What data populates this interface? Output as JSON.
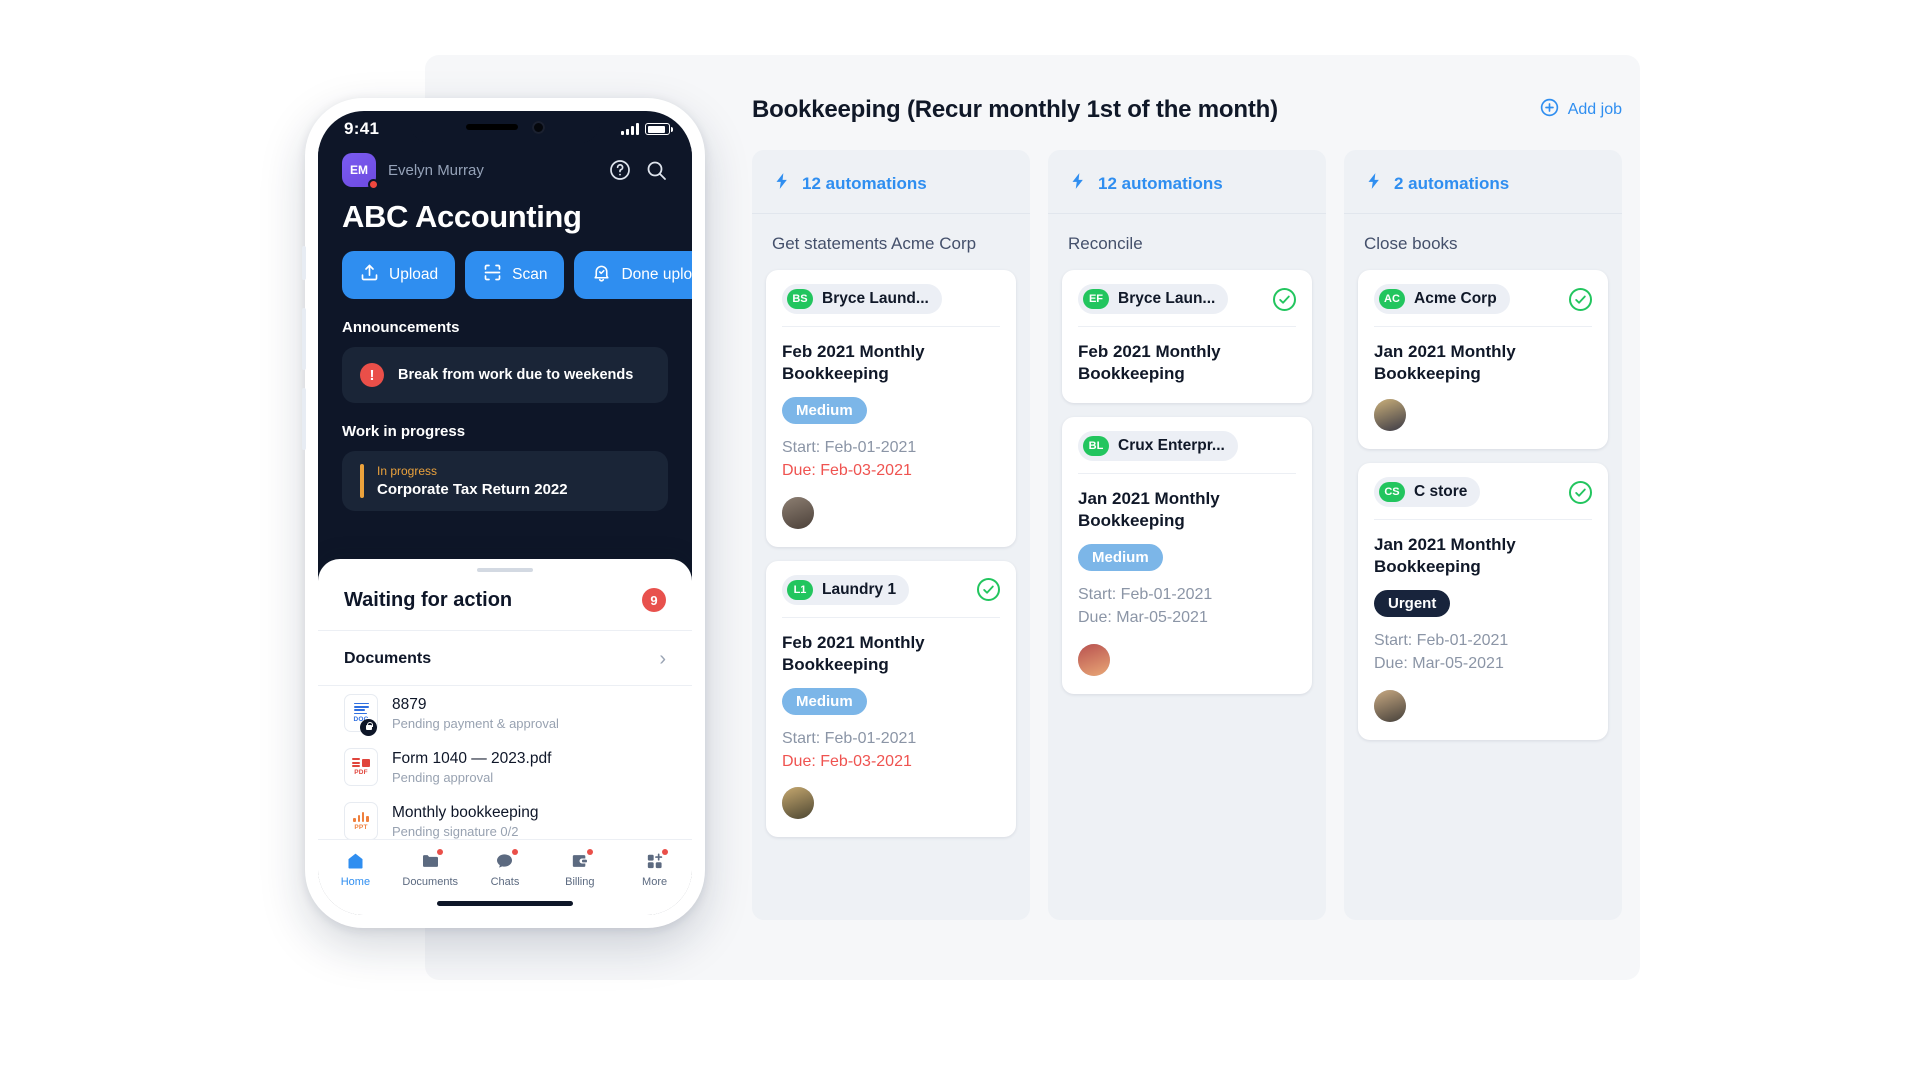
{
  "phone": {
    "status": {
      "time": "9:41",
      "signal_icon": "signal-bars-icon",
      "battery_icon": "battery-icon"
    },
    "user": {
      "initials": "EM",
      "name": "Evelyn Murray"
    },
    "header_icons": [
      {
        "name": "help-icon",
        "glyph": "?"
      },
      {
        "name": "search-icon",
        "glyph": "search"
      }
    ],
    "company_title": "ABC Accounting",
    "actions": [
      {
        "label": "Upload",
        "icon": "upload-icon"
      },
      {
        "label": "Scan",
        "icon": "scan-icon"
      },
      {
        "label": "Done uploading",
        "icon": "bell-check-icon"
      }
    ],
    "announcements": {
      "heading": "Announcements",
      "items": [
        {
          "text": "Break from work due to weekends",
          "icon": "alert-icon"
        }
      ]
    },
    "work_in_progress": {
      "heading": "Work in progress",
      "items": [
        {
          "status": "In progress",
          "title": "Corporate Tax Return 2022",
          "accent": "#eba23c"
        }
      ]
    },
    "sheet": {
      "title": "Waiting for action",
      "badge": "9",
      "documents_heading": "Documents",
      "chevron_icon": "chevron-right-icon",
      "documents": [
        {
          "name": "8879",
          "status": "Pending payment & approval",
          "type": "DOC",
          "locked": true
        },
        {
          "name": "Form 1040 — 2023.pdf",
          "status": "Pending approval",
          "type": "PDF",
          "locked": false
        },
        {
          "name": "Monthly bookkeeping",
          "status": "Pending signature 0/2",
          "type": "PPT",
          "locked": false
        }
      ]
    },
    "tabs": [
      {
        "label": "Home",
        "icon": "home-icon",
        "active": true,
        "badge": false
      },
      {
        "label": "Documents",
        "icon": "folder-icon",
        "active": false,
        "badge": true
      },
      {
        "label": "Chats",
        "icon": "chat-icon",
        "active": false,
        "badge": true
      },
      {
        "label": "Billing",
        "icon": "wallet-icon",
        "active": false,
        "badge": true
      },
      {
        "label": "More",
        "icon": "grid-plus-icon",
        "active": false,
        "badge": true
      }
    ]
  },
  "board": {
    "title": "Bookkeeping (Recur monthly 1st of the month)",
    "add_job": {
      "label": "Add job",
      "icon": "plus-circle-icon"
    },
    "columns": [
      {
        "automations": "12 automations",
        "automation_icon": "lightning-icon",
        "name": "Get statements Acme Corp",
        "cards": [
          {
            "client_initials": "BS",
            "client_name": "Bryce Laund...",
            "completed": false,
            "title": "Feb 2021 Monthly Bookkeeping",
            "priority": "Medium",
            "priority_style": "medium",
            "start": "Start: Feb-01-2021",
            "due": "Due: Feb-03-2021",
            "due_overdue": true,
            "avatar": "assignee-avatar"
          },
          {
            "client_initials": "L1",
            "client_name": "Laundry 1",
            "completed": true,
            "title": "Feb 2021 Monthly Bookkeeping",
            "priority": "Medium",
            "priority_style": "medium",
            "start": "Start: Feb-01-2021",
            "due": "Due: Feb-03-2021",
            "due_overdue": true,
            "avatar": "assignee-avatar"
          }
        ]
      },
      {
        "automations": "12 automations",
        "automation_icon": "lightning-icon",
        "name": "Reconcile",
        "cards": [
          {
            "client_initials": "EF",
            "client_name": "Bryce Laun...",
            "completed": true,
            "title": "Feb 2021 Monthly Bookkeeping",
            "priority": "",
            "priority_style": "",
            "start": "",
            "due": "",
            "due_overdue": false,
            "avatar": ""
          },
          {
            "client_initials": "BL",
            "client_name": "Crux Enterpr...",
            "completed": false,
            "title": "Jan 2021 Monthly Bookkeeping",
            "priority": "Medium",
            "priority_style": "medium",
            "start": "Start: Feb-01-2021",
            "due": "Due: Mar-05-2021",
            "due_overdue": false,
            "avatar": "assignee-avatar"
          }
        ]
      },
      {
        "automations": "2 automations",
        "automation_icon": "lightning-icon",
        "name": "Close books",
        "cards": [
          {
            "client_initials": "AC",
            "client_name": "Acme Corp",
            "completed": true,
            "title": "Jan 2021 Monthly Bookkeeping",
            "priority": "",
            "priority_style": "",
            "start": "",
            "due": "",
            "due_overdue": false,
            "avatar": "assignee-avatar"
          },
          {
            "client_initials": "CS",
            "client_name": "C store",
            "completed": true,
            "title": "Jan 2021 Monthly Bookkeeping",
            "priority": "Urgent",
            "priority_style": "urgent",
            "start": "Start: Feb-01-2021",
            "due": "Due: Mar-05-2021",
            "due_overdue": false,
            "avatar": "assignee-avatar"
          }
        ]
      }
    ]
  },
  "colors": {
    "accent_blue": "#2f8ef0",
    "dark_navy": "#0e1628",
    "green": "#22c55e",
    "red": "#ea4f49",
    "overdue_red": "#ef5350",
    "amber": "#eba23c",
    "medium_pill": "#7cb6e8",
    "urgent_pill": "#18243c"
  }
}
